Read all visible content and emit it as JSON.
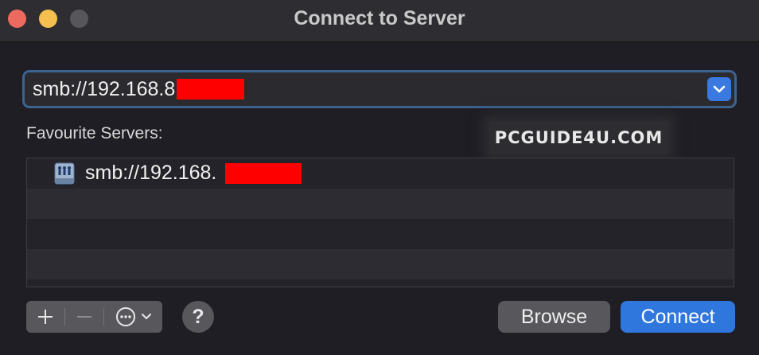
{
  "window": {
    "title": "Connect to Server",
    "buttons": [
      "close",
      "minimize",
      "zoom"
    ],
    "colors": {
      "close": "#ec6a5e",
      "minimize": "#f4bf4f",
      "zoom": "#57565a"
    }
  },
  "address": {
    "value": "smb://192.168.8",
    "dropdown_icon": "chevron-down-icon",
    "accent": "#3a7ae0"
  },
  "favourites": {
    "label": "Favourite Servers:",
    "items": [
      {
        "icon": "server-icon",
        "label": "smb://192.168."
      }
    ]
  },
  "watermark": "PCGUIDE4U.COM",
  "toolbar": {
    "add_icon": "plus-icon",
    "remove_icon": "minus-icon",
    "more_icon": "ellipsis-circle-icon",
    "help_label": "?"
  },
  "actions": {
    "browse_label": "Browse",
    "connect_label": "Connect",
    "connect_color": "#2f76dd"
  }
}
